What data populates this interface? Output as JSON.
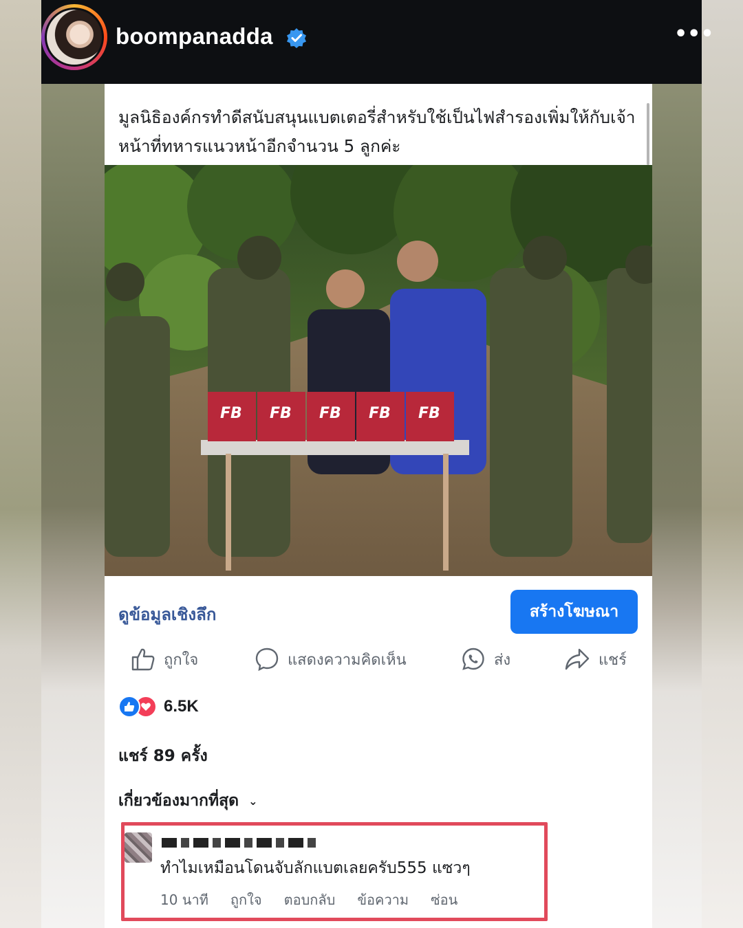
{
  "instagram": {
    "username": "boompanadda",
    "more_icon": "more-dots-icon",
    "verified_icon": "verified-badge-icon"
  },
  "post": {
    "caption": "มูลนิธิองค์กรทำดีสนับสนุนแบตเตอรี่สำหรับใช้เป็นไฟสำรองเพิ่มให้กับเจ้าหน้าที่ทหารแนวหน้าอีกจำนวน 5 ลูกค่ะ",
    "photo_box_label": "FB"
  },
  "cta": {
    "insights_label": "ดูข้อมูลเชิงลึก",
    "ad_button_label": "สร้างโฆษณา",
    "ad_button_color": "#1877f2"
  },
  "actions": {
    "like_label": "ถูกใจ",
    "comment_label": "แสดงความคิดเห็น",
    "send_label": "ส่ง",
    "share_label": "แชร์"
  },
  "stats": {
    "reaction_count": "6.5K",
    "shares_text": "แชร์ 89 ครั้ง"
  },
  "comments": {
    "sort_label": "เกี่ยวข้องมากที่สุด",
    "highlight_color": "#e14a5b",
    "items": [
      {
        "text": "ทำไมเหมือนโดนจับลักแบตเลยครับ555 แซวๆ",
        "time": "10 นาที",
        "like": "ถูกใจ",
        "reply": "ตอบกลับ",
        "message": "ข้อความ",
        "hide": "ซ่อน"
      }
    ]
  }
}
